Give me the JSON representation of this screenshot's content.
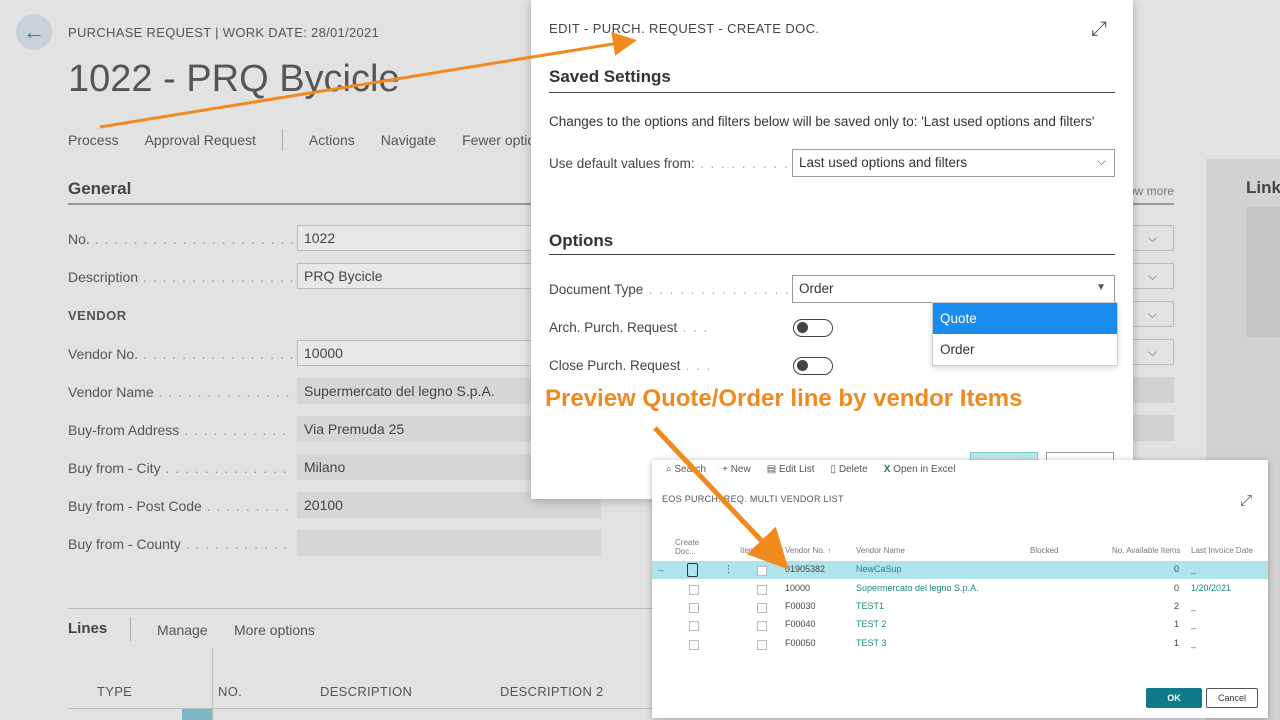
{
  "colors": {
    "accent": "#f0891e",
    "selected": "#1a8cf0",
    "teal": "#0e7a8a"
  },
  "page": {
    "breadcrumb": "PURCHASE REQUEST | WORK DATE: 28/01/2021",
    "title": "1022 - PRQ Bycicle",
    "actions": [
      "Process",
      "Approval Request",
      "Actions",
      "Navigate",
      "Fewer optio"
    ],
    "general_header": "General",
    "show_more": "ow more",
    "link_header": "Link",
    "vendor_header": "VENDOR",
    "fields": {
      "no": {
        "label": "No.",
        "value": "1022"
      },
      "description": {
        "label": "Description",
        "value": "PRQ Bycicle"
      },
      "vendor_no": {
        "label": "Vendor No.",
        "value": "10000"
      },
      "vendor_name": {
        "label": "Vendor Name",
        "value": "Supermercato del legno S.p.A."
      },
      "buy_from_address": {
        "label": "Buy-from Address",
        "value": "Via Premuda 25"
      },
      "buy_from_city": {
        "label": "Buy from - City",
        "value": "Milano"
      },
      "buy_from_post": {
        "label": "Buy from - Post Code",
        "value": "20100"
      },
      "buy_from_county": {
        "label": "Buy from - County",
        "value": ""
      }
    },
    "lines": {
      "header": "Lines",
      "manage": "Manage",
      "more_options": "More options",
      "columns": [
        "TYPE",
        "NO.",
        "DESCRIPTION",
        "DESCRIPTION 2"
      ]
    }
  },
  "dialog": {
    "title": "EDIT - PURCH. REQUEST - CREATE DOC.",
    "saved_settings_header": "Saved Settings",
    "saved_text": "Changes to the options and filters below will be saved only to: 'Last used options and filters'",
    "use_default_label": "Use default values from:",
    "use_default_value": "Last used options and filters",
    "options_header": "Options",
    "document_type_label": "Document Type",
    "document_type_value": "Order",
    "arch_label": "Arch. Purch. Request",
    "close_label": "Close Purch. Request",
    "dropdown_options": [
      "Quote",
      "Order"
    ]
  },
  "callout": "Preview Quote/Order line by vendor Items",
  "inset": {
    "toolbar": [
      "Search",
      "New",
      "Edit List",
      "Delete",
      "Open in Excel"
    ],
    "title": "EOS PURCH. REQ. MULTI VENDOR LIST",
    "headers": [
      "Create Doc...",
      "Items",
      "Vendor No. ↑",
      "Vendor Name",
      "Blocked",
      "No. Available Items",
      "Last Invoice Date"
    ],
    "rows": [
      {
        "vendor_no": "01905382",
        "vendor_name": "NewCaSup",
        "available": "0",
        "last_invoice": "_"
      },
      {
        "vendor_no": "10000",
        "vendor_name": "Supermercato del legno S.p.A.",
        "available": "0",
        "last_invoice": "1/20/2021"
      },
      {
        "vendor_no": "F00030",
        "vendor_name": "TEST1",
        "available": "2",
        "last_invoice": "_"
      },
      {
        "vendor_no": "F00040",
        "vendor_name": "TEST 2",
        "available": "1",
        "last_invoice": "_"
      },
      {
        "vendor_no": "F00050",
        "vendor_name": "TEST 3",
        "available": "1",
        "last_invoice": "_"
      }
    ],
    "ok": "OK",
    "cancel": "Cancel"
  }
}
